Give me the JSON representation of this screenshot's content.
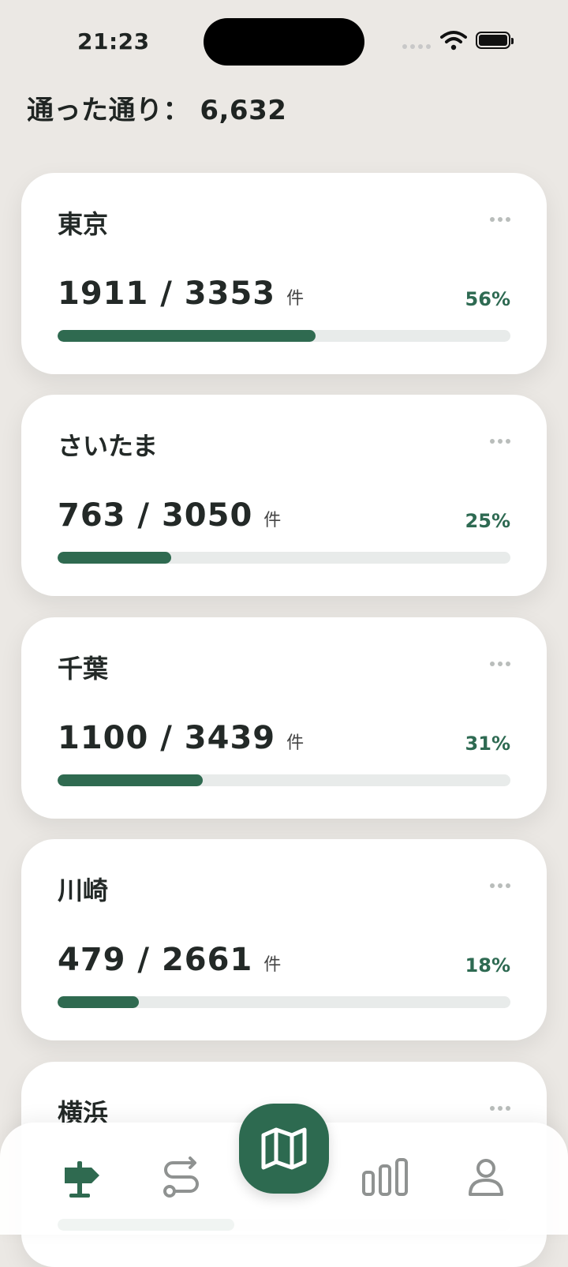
{
  "status_bar": {
    "time": "21:23"
  },
  "header": {
    "title": "通った通り： 6,632"
  },
  "cards": [
    {
      "name": "東京",
      "count": "1911 / 3353",
      "unit": "件",
      "percent_label": "56%",
      "progress": 0.57
    },
    {
      "name": "さいたま",
      "count": "763 / 3050",
      "unit": "件",
      "percent_label": "25%",
      "progress": 0.25
    },
    {
      "name": "千葉",
      "count": "1100 / 3439",
      "unit": "件",
      "percent_label": "31%",
      "progress": 0.32
    },
    {
      "name": "川崎",
      "count": "479 / 2661",
      "unit": "件",
      "percent_label": "18%",
      "progress": 0.18
    },
    {
      "name": "横浜",
      "count": "",
      "unit": "",
      "percent_label": "",
      "progress": 0.39
    }
  ],
  "tabs": [
    {
      "icon": "signpost-icon",
      "active": true
    },
    {
      "icon": "route-icon",
      "active": false
    },
    {
      "icon": "map-icon",
      "active": false
    },
    {
      "icon": "bar-chart-icon",
      "active": false
    },
    {
      "icon": "person-icon",
      "active": false
    }
  ],
  "colors": {
    "accent": "#2f6a50",
    "background": "#ebe8e4",
    "track": "#e8ebea"
  }
}
